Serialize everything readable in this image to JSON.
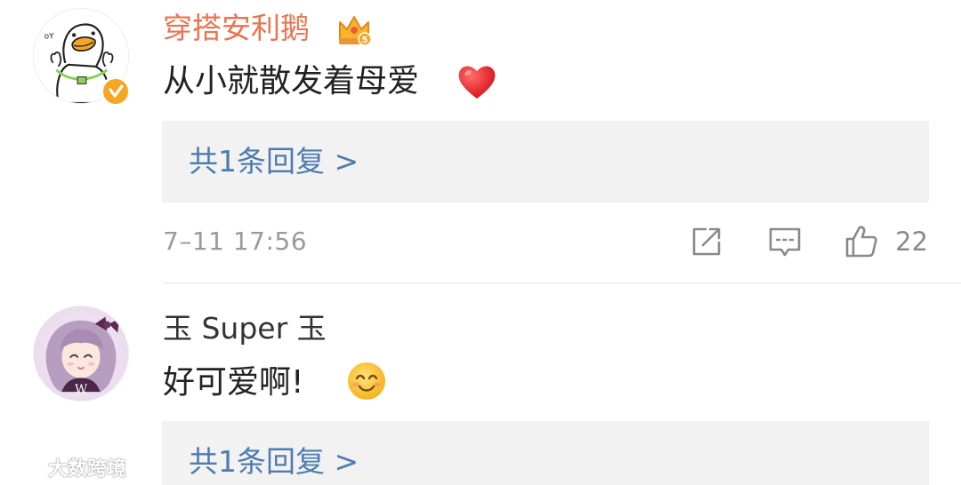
{
  "comments": [
    {
      "username": "穿搭安利鹅",
      "text": "从小就散发着母爱",
      "reaction_emoji": "red-heart-icon",
      "replies_label": "共1条回复 >",
      "timestamp": "7–11 17:56",
      "like_count": "22",
      "is_verified": true,
      "has_vip_crown": true,
      "crown_level": "5"
    },
    {
      "username": "玉 Super 玉",
      "text": "好可爱啊!",
      "reaction_emoji": "smiling-face-icon",
      "replies_label": "共1条回复 >"
    }
  ],
  "actions": [
    "share-icon",
    "comment-icon",
    "like-icon"
  ],
  "watermark": {
    "text": "大数跨境"
  },
  "colors": {
    "vip_name": "#eb7350",
    "link_blue": "#4f7cae",
    "reply_bg": "#f2f2f2",
    "meta_gray": "#9a9a9a",
    "verified_badge": "#f5a623"
  }
}
